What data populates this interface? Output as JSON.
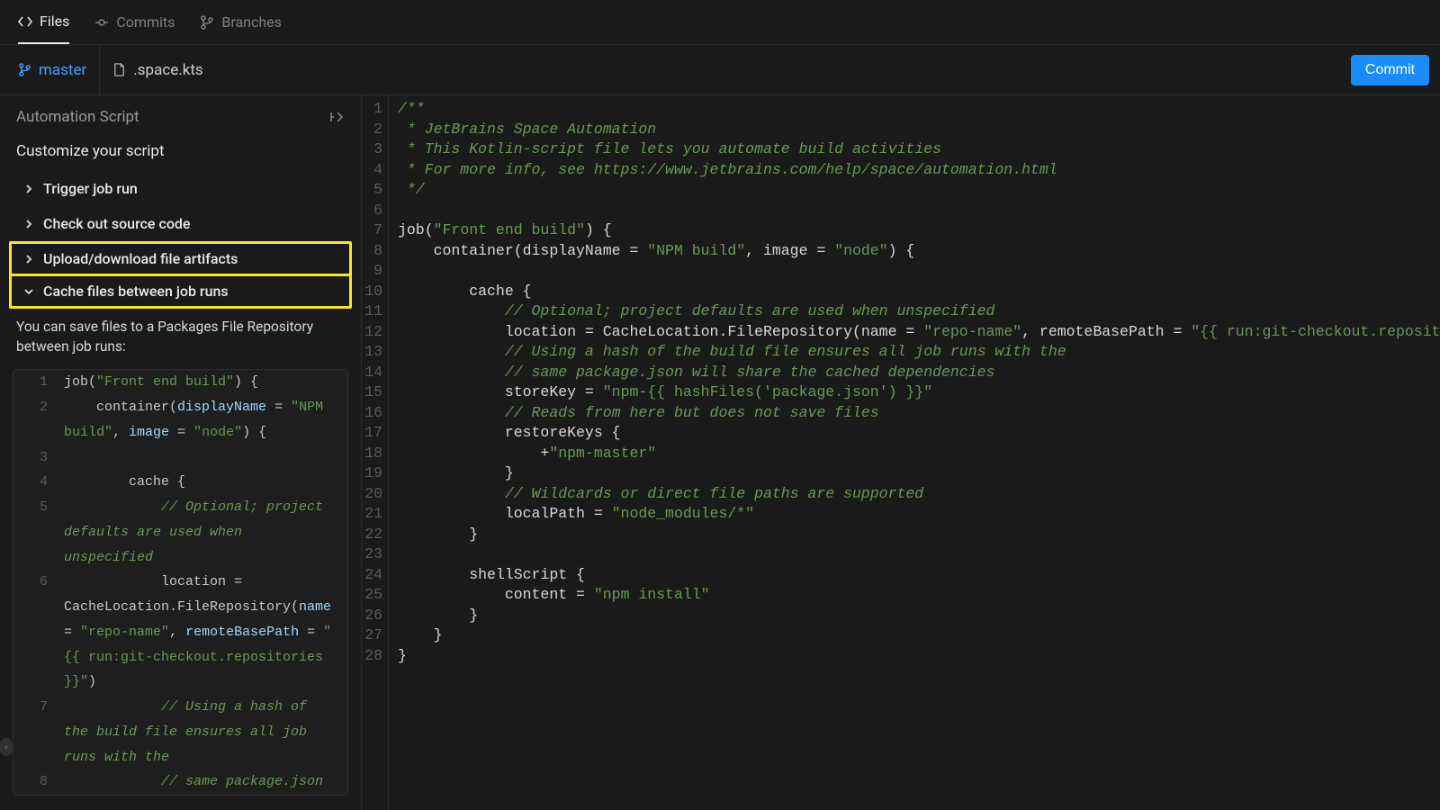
{
  "tabs": {
    "files": "Files",
    "commits": "Commits",
    "branches": "Branches"
  },
  "subbar": {
    "branch": "master",
    "filename": ".space.kts",
    "commit": "Commit"
  },
  "sidebar": {
    "title": "Automation Script",
    "customize": "Customize your script",
    "items": [
      "Trigger job run",
      "Check out source code",
      "Upload/download file artifacts",
      "Cache files between job runs"
    ],
    "help": "You can save files to a Packages File Repository between job runs:"
  },
  "snippet": [
    {
      "n": "1",
      "segs": [
        {
          "t": "job(",
          "c": ""
        },
        {
          "t": "\"Front end build\"",
          "c": "c-str"
        },
        {
          "t": ") {",
          "c": ""
        }
      ]
    },
    {
      "n": "2",
      "segs": [
        {
          "t": "    container(",
          "c": ""
        },
        {
          "t": "displayName",
          "c": "c-param"
        },
        {
          "t": " = ",
          "c": ""
        },
        {
          "t": "\"NPM build\"",
          "c": "c-str"
        },
        {
          "t": ", ",
          "c": ""
        },
        {
          "t": "image",
          "c": "c-param"
        },
        {
          "t": " = ",
          "c": ""
        },
        {
          "t": "\"node\"",
          "c": "c-str"
        },
        {
          "t": ") {",
          "c": ""
        }
      ]
    },
    {
      "n": "3",
      "segs": [
        {
          "t": " ",
          "c": ""
        }
      ]
    },
    {
      "n": "4",
      "segs": [
        {
          "t": "        cache {",
          "c": ""
        }
      ]
    },
    {
      "n": "5",
      "segs": [
        {
          "t": "            // Optional; project defaults are used when unspecified",
          "c": "c-comment"
        }
      ]
    },
    {
      "n": "6",
      "segs": [
        {
          "t": "            location = CacheLocation.FileRepository(",
          "c": ""
        },
        {
          "t": "name",
          "c": "c-param"
        },
        {
          "t": " = ",
          "c": ""
        },
        {
          "t": "\"repo-name\"",
          "c": "c-str"
        },
        {
          "t": ", ",
          "c": ""
        },
        {
          "t": "remoteBasePath",
          "c": "c-param"
        },
        {
          "t": " = ",
          "c": ""
        },
        {
          "t": "\"{{ run:git-checkout.repositories }}\"",
          "c": "c-str"
        },
        {
          "t": ")",
          "c": ""
        }
      ]
    },
    {
      "n": "7",
      "segs": [
        {
          "t": "            // Using a hash of the build file ensures all job runs with the",
          "c": "c-comment"
        }
      ]
    },
    {
      "n": "8",
      "segs": [
        {
          "t": "            // same package.json",
          "c": "c-comment"
        }
      ]
    }
  ],
  "editor": {
    "lines": [
      [
        {
          "t": "/**",
          "c": "c-comment"
        }
      ],
      [
        {
          "t": " * JetBrains Space Automation",
          "c": "c-comment"
        }
      ],
      [
        {
          "t": " * This Kotlin-script file lets you automate build activities",
          "c": "c-comment"
        }
      ],
      [
        {
          "t": " * For more info, see https://www.jetbrains.com/help/space/automation.html",
          "c": "c-comment"
        }
      ],
      [
        {
          "t": " */",
          "c": "c-comment"
        }
      ],
      [
        {
          "t": "",
          "c": ""
        }
      ],
      [
        {
          "t": "job(",
          "c": "c-id"
        },
        {
          "t": "\"Front end build\"",
          "c": "c-str"
        },
        {
          "t": ") {",
          "c": "c-id"
        }
      ],
      [
        {
          "t": "    container(displayName = ",
          "c": "c-id"
        },
        {
          "t": "\"NPM build\"",
          "c": "c-str"
        },
        {
          "t": ", image = ",
          "c": "c-id"
        },
        {
          "t": "\"node\"",
          "c": "c-str"
        },
        {
          "t": ") {",
          "c": "c-id"
        }
      ],
      [
        {
          "t": "",
          "c": ""
        }
      ],
      [
        {
          "t": "        cache {",
          "c": "c-id"
        }
      ],
      [
        {
          "t": "            // Optional; project defaults are used when unspecified",
          "c": "c-comment"
        }
      ],
      [
        {
          "t": "            location = CacheLocation.FileRepository(name = ",
          "c": "c-id"
        },
        {
          "t": "\"repo-name\"",
          "c": "c-str"
        },
        {
          "t": ", remoteBasePath = ",
          "c": "c-id"
        },
        {
          "t": "\"{{ run:git-checkout.repositori",
          "c": "c-str"
        }
      ],
      [
        {
          "t": "            // Using a hash of the build file ensures all job runs with the",
          "c": "c-comment"
        }
      ],
      [
        {
          "t": "            // same package.json will share the cached dependencies",
          "c": "c-comment"
        }
      ],
      [
        {
          "t": "            storeKey = ",
          "c": "c-id"
        },
        {
          "t": "\"npm-{{ hashFiles('package.json') }}\"",
          "c": "c-str"
        }
      ],
      [
        {
          "t": "            // Reads from here but does not save files",
          "c": "c-comment"
        }
      ],
      [
        {
          "t": "            restoreKeys {",
          "c": "c-id"
        }
      ],
      [
        {
          "t": "                +",
          "c": "c-id"
        },
        {
          "t": "\"npm-master\"",
          "c": "c-str"
        }
      ],
      [
        {
          "t": "            }",
          "c": "c-id"
        }
      ],
      [
        {
          "t": "            // Wildcards or direct file paths are supported",
          "c": "c-comment"
        }
      ],
      [
        {
          "t": "            localPath = ",
          "c": "c-id"
        },
        {
          "t": "\"node_modules/*\"",
          "c": "c-str"
        }
      ],
      [
        {
          "t": "        }",
          "c": "c-id"
        }
      ],
      [
        {
          "t": "",
          "c": ""
        }
      ],
      [
        {
          "t": "        shellScript {",
          "c": "c-id"
        }
      ],
      [
        {
          "t": "            content = ",
          "c": "c-id"
        },
        {
          "t": "\"npm install\"",
          "c": "c-str"
        }
      ],
      [
        {
          "t": "        }",
          "c": "c-id"
        }
      ],
      [
        {
          "t": "    }",
          "c": "c-id"
        }
      ],
      [
        {
          "t": "}",
          "c": "c-id"
        }
      ]
    ]
  }
}
